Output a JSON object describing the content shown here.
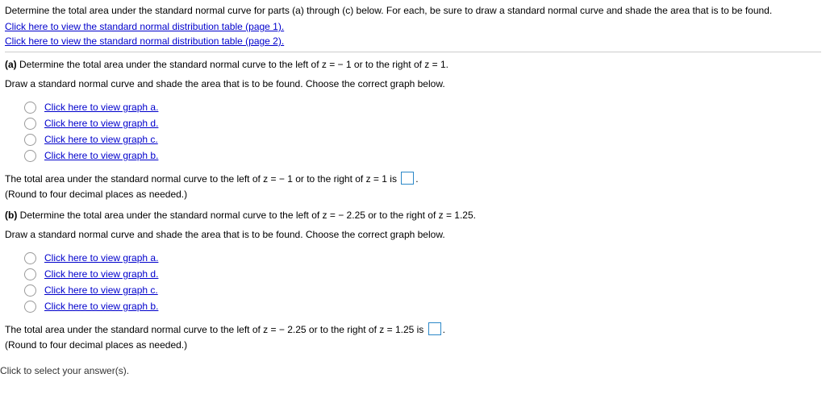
{
  "intro": {
    "text": "Determine the total area under the standard normal curve for parts (a) through (c) below. For each, be sure to draw a standard normal curve and shade the area that is to be found.",
    "link_page1": "Click here to view the standard normal distribution table (page 1).",
    "link_page2": "Click here to view the standard normal distribution table (page 2)."
  },
  "part_a": {
    "label": "(a)",
    "heading": " Determine the total area under the standard normal curve to the left of z = − 1 or to the right of z = 1.",
    "draw_instruction": "Draw a standard normal curve and shade the area that is to be found. Choose the correct graph below.",
    "options": [
      "Click here to view graph a.",
      "Click here to view graph d.",
      "Click here to view graph c.",
      "Click here to view graph b."
    ],
    "answer_prefix": "The total area under the standard normal curve to the left of z = − 1 or to the right of z = 1 is ",
    "answer_suffix": ".",
    "round_note": "(Round to four decimal places as needed.)"
  },
  "part_b": {
    "label": "(b)",
    "heading": " Determine the total area under the standard normal curve to the left of z = − 2.25 or to the right of z = 1.25.",
    "draw_instruction": "Draw a standard normal curve and shade the area that is to be found. Choose the correct graph below.",
    "options": [
      "Click here to view graph a.",
      "Click here to view graph d.",
      "Click here to view graph c.",
      "Click here to view graph b."
    ],
    "answer_prefix": "The total area under the standard normal curve to the left of z = − 2.25 or to the right of z = 1.25 is ",
    "answer_suffix": ".",
    "round_note": "(Round to four decimal places as needed.)"
  },
  "footer": "Click to select your answer(s)."
}
